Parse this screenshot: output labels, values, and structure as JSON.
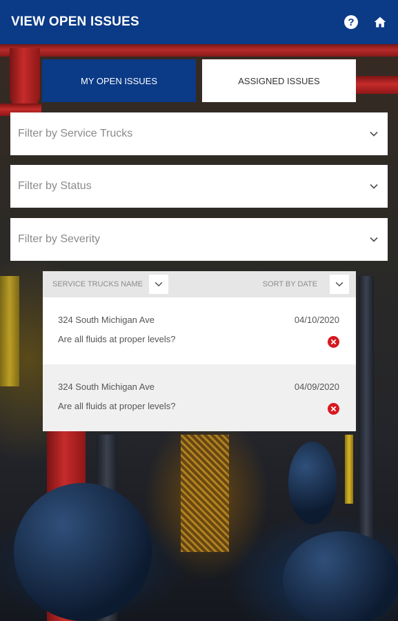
{
  "header": {
    "title": "VIEW OPEN ISSUES",
    "help_icon": "help-circle-icon",
    "home_icon": "home-icon",
    "background_color": "#0b3a86"
  },
  "tabs": [
    {
      "label": "MY OPEN ISSUES",
      "active": true
    },
    {
      "label": "ASSIGNED ISSUES",
      "active": false
    }
  ],
  "filters": {
    "service_trucks": {
      "placeholder": "Filter by Service Trucks",
      "icon": "chevron-down-icon"
    },
    "status": {
      "placeholder": "Filter by Status",
      "icon": "chevron-down-icon"
    },
    "severity": {
      "placeholder": "Filter by Severity",
      "icon": "chevron-down-icon"
    }
  },
  "issues_list": {
    "name_sort_label": "SERVICE TRUCKS NAME",
    "date_sort_label": "SORT BY DATE",
    "items": [
      {
        "location": "324 South Michigan Ave",
        "date": "04/10/2020",
        "question": "Are all fluids at proper levels?",
        "status_icon": "error-x-icon"
      },
      {
        "location": "324 South Michigan Ave",
        "date": "04/09/2020",
        "question": "Are all fluids at proper levels?",
        "status_icon": "error-x-icon"
      }
    ]
  },
  "colors": {
    "primary": "#0b3a86",
    "error": "#d71920"
  }
}
